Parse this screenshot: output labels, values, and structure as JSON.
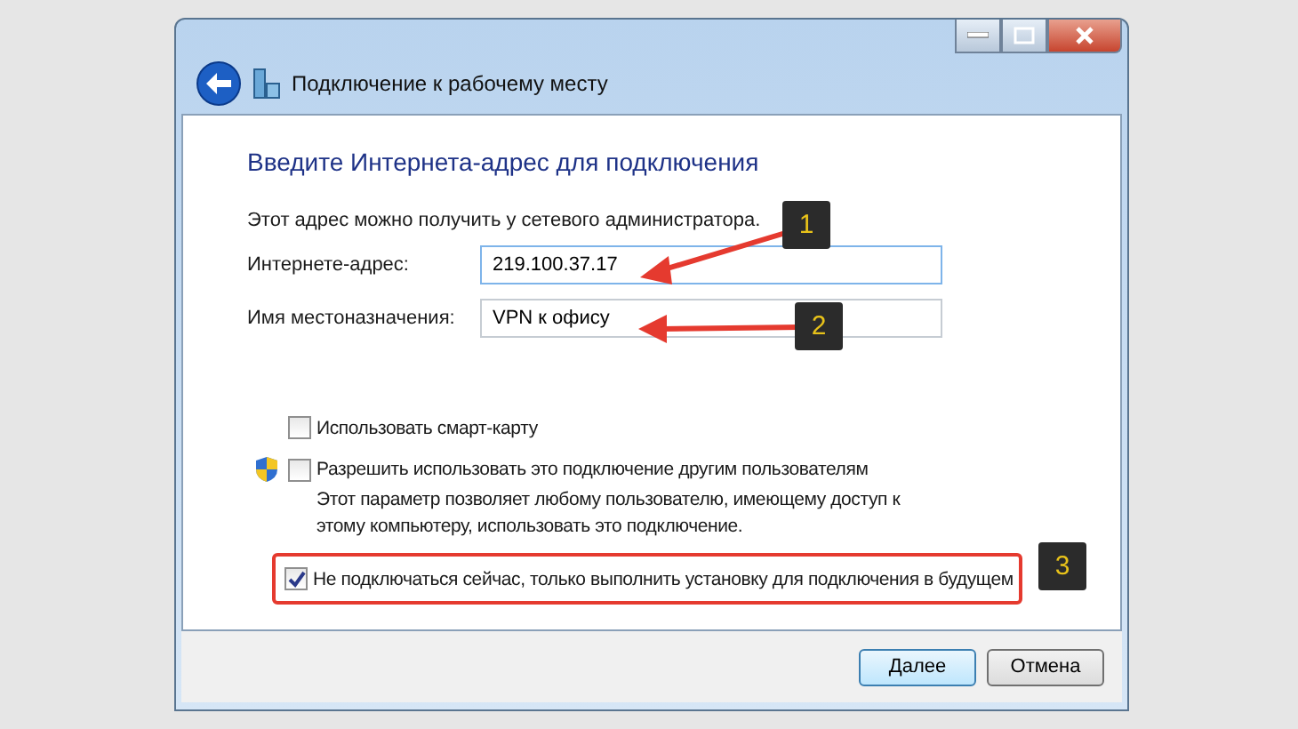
{
  "window": {
    "title": "Подключение к рабочему месту"
  },
  "heading": "Введите Интернета-адрес для подключения",
  "note": "Этот адрес можно получить у сетевого администратора.",
  "fields": [
    {
      "label": "Интернете-адрес:",
      "value": "219.100.37.17",
      "focused": true
    },
    {
      "label": "Имя местоназначения:",
      "value": "VPN к офису",
      "focused": false
    }
  ],
  "options": [
    {
      "label": "Использовать смарт-карту",
      "checked": false,
      "shield": false,
      "highlighted": false
    },
    {
      "label": "Разрешить использовать это подключение другим пользователям",
      "checked": false,
      "shield": true,
      "highlighted": false,
      "description": "Этот параметр позволяет любому пользователю, имеющему доступ к этому компьютеру, использовать это подключение."
    },
    {
      "label": "Не подключаться сейчас, только выполнить установку для подключения в будущем",
      "checked": true,
      "shield": false,
      "highlighted": true
    }
  ],
  "callouts": [
    {
      "number": "1"
    },
    {
      "number": "2"
    },
    {
      "number": "3"
    }
  ],
  "buttons": [
    {
      "label": "Далее",
      "default": true
    },
    {
      "label": "Отмена",
      "default": false
    }
  ]
}
